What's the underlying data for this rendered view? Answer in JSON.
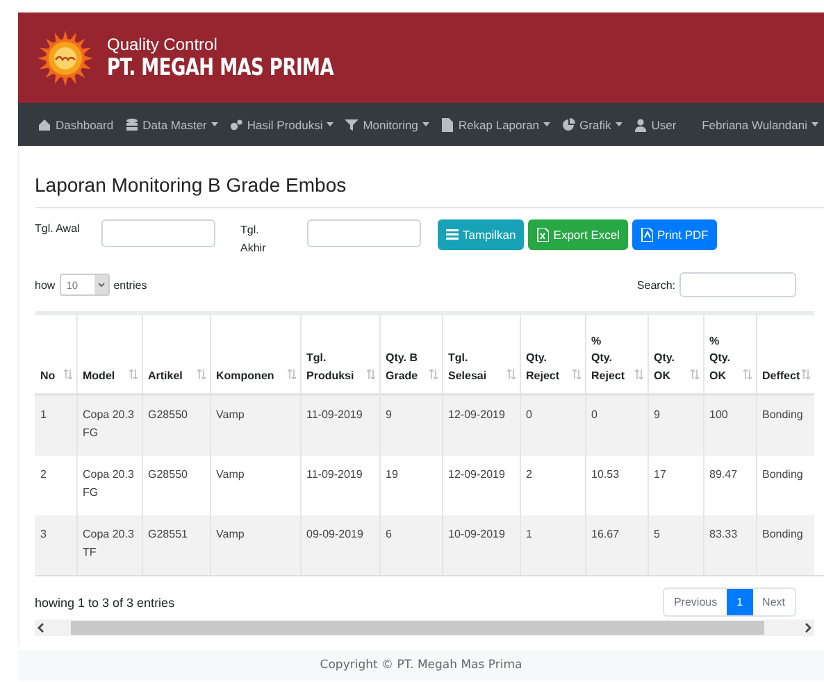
{
  "header": {
    "subtitle": "Quality Control",
    "brand": "PT. MEGAH MAS PRIMA"
  },
  "nav": {
    "items": [
      {
        "label": "Dashboard",
        "kind": "house",
        "dropdown": false
      },
      {
        "label": "Data Master",
        "kind": "db",
        "dropdown": true
      },
      {
        "label": "Hasil Produksi",
        "kind": "gears",
        "dropdown": true
      },
      {
        "label": "Monitoring",
        "kind": "filter",
        "dropdown": true
      },
      {
        "label": "Rekap Laporan",
        "kind": "file",
        "dropdown": true
      },
      {
        "label": "Grafik",
        "kind": "pie",
        "dropdown": true
      },
      {
        "label": "User",
        "kind": "user",
        "dropdown": false
      }
    ],
    "user": {
      "label": "Febriana Wulandani",
      "dropdown": true
    }
  },
  "title": "Laporan Monitoring B Grade Embos",
  "filters": [
    {
      "label": "Tgl. Awal"
    },
    {
      "label": "Tgl. Akhir"
    }
  ],
  "buttons": [
    {
      "label": "Tampilkan",
      "kind": "list"
    },
    {
      "label": "Export Excel",
      "kind": "excel"
    },
    {
      "label": "Print PDF",
      "kind": "pdf"
    }
  ],
  "length": {
    "prefix": "how",
    "value": "10",
    "suffix": "entries"
  },
  "search": {
    "label": "Search:"
  },
  "table": {
    "columns": [
      "No",
      "Model",
      "Artikel",
      "Komponen",
      "Tgl. Produksi",
      "Qty. B Grade",
      "Tgl. Selesai",
      "Qty. Reject",
      "% Qty. Reject",
      "Qty. OK",
      "% Qty. OK",
      "Deffect"
    ],
    "rows": [
      [
        "1",
        "Copa 20.3 FG",
        "G28550",
        "Vamp",
        "11-09-2019",
        "9",
        "12-09-2019",
        "0",
        "0",
        "9",
        "100",
        "Bonding"
      ],
      [
        "2",
        "Copa 20.3 FG",
        "G28550",
        "Vamp",
        "11-09-2019",
        "19",
        "12-09-2019",
        "2",
        "10.53",
        "17",
        "89.47",
        "Bonding"
      ],
      [
        "3",
        "Copa 20.3 TF",
        "G28551",
        "Vamp",
        "09-09-2019",
        "6",
        "10-09-2019",
        "1",
        "16.67",
        "5",
        "83.33",
        "Bonding"
      ]
    ]
  },
  "info": "howing 1 to 3 of 3 entries",
  "pagination": [
    {
      "label": "Previous",
      "selected": false
    },
    {
      "label": "1",
      "selected": true
    },
    {
      "label": "Next",
      "selected": false
    }
  ],
  "footer": "Copyright © PT. Megah Mas Prima"
}
